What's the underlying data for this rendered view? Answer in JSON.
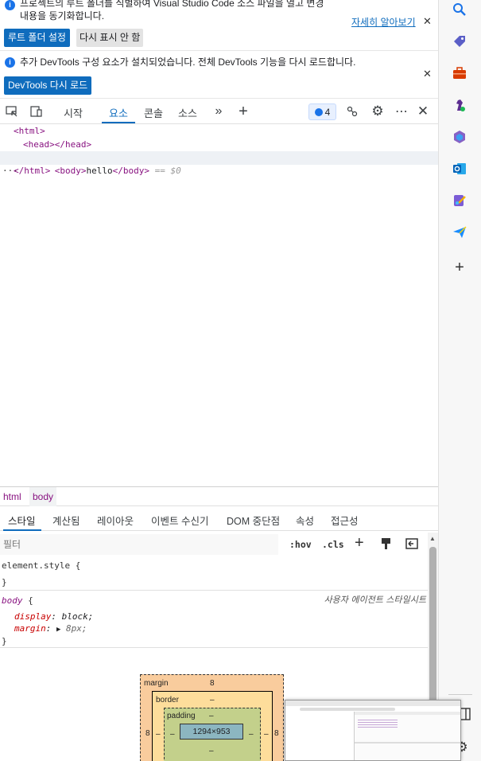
{
  "info_bar_1": {
    "message_line1": "프로젝트의 루트 폴더를 식별하여 Visual Studio Code 소스 파일을 열고 변경",
    "message_line2": "내용을 동기화합니다.",
    "link": "자세히 알아보기",
    "primary_button": "루트 폴더 설정",
    "secondary_button": "다시 표시 안 함"
  },
  "info_bar_2": {
    "message": "추가 DevTools 구성 요소가 설치되었습니다. 전체 DevTools 기능을 다시 로드합니다.",
    "primary_button": "DevTools 다시 로드"
  },
  "toolbar": {
    "tabs": [
      "시작",
      "요소",
      "콘솔",
      "소스"
    ],
    "active_tab": "요소",
    "issues_count": "4"
  },
  "dom_tree": {
    "lines": [
      "<html>",
      "<head></head>",
      "hello",
      "</html>"
    ],
    "body_open": "<body>",
    "body_close": "</body>",
    "head_line": "<head></head>",
    "selected_marker": "== $0",
    "ellipsis": "···"
  },
  "breadcrumb": {
    "items": [
      "html",
      "body"
    ]
  },
  "subtabs": {
    "items": [
      "스타일",
      "계산됨",
      "레이아웃",
      "이벤트 수신기",
      "DOM 중단점",
      "속성",
      "접근성"
    ],
    "active": "스타일"
  },
  "filter": {
    "placeholder": "필터",
    "hov": ":hov",
    "cls": ".cls"
  },
  "styles": {
    "element_style": "element.style {",
    "close_brace": "}",
    "body_selector": "body",
    "body_open": " {",
    "ua_label": "사용자 에이전트 스타일시트",
    "props": [
      {
        "name": "display",
        "value": "block;"
      },
      {
        "name": "margin",
        "value": "8px;"
      }
    ]
  },
  "box_model": {
    "margin_label": "margin",
    "margin_value": "8",
    "border_label": "border",
    "border_value": "–",
    "padding_label": "padding",
    "padding_value": "–",
    "content": "1294×953",
    "side_margin": "8",
    "side_dash": "–"
  },
  "colors": {
    "accent": "#0f6cbd",
    "tag": "#881280",
    "prop": "#c80000"
  }
}
